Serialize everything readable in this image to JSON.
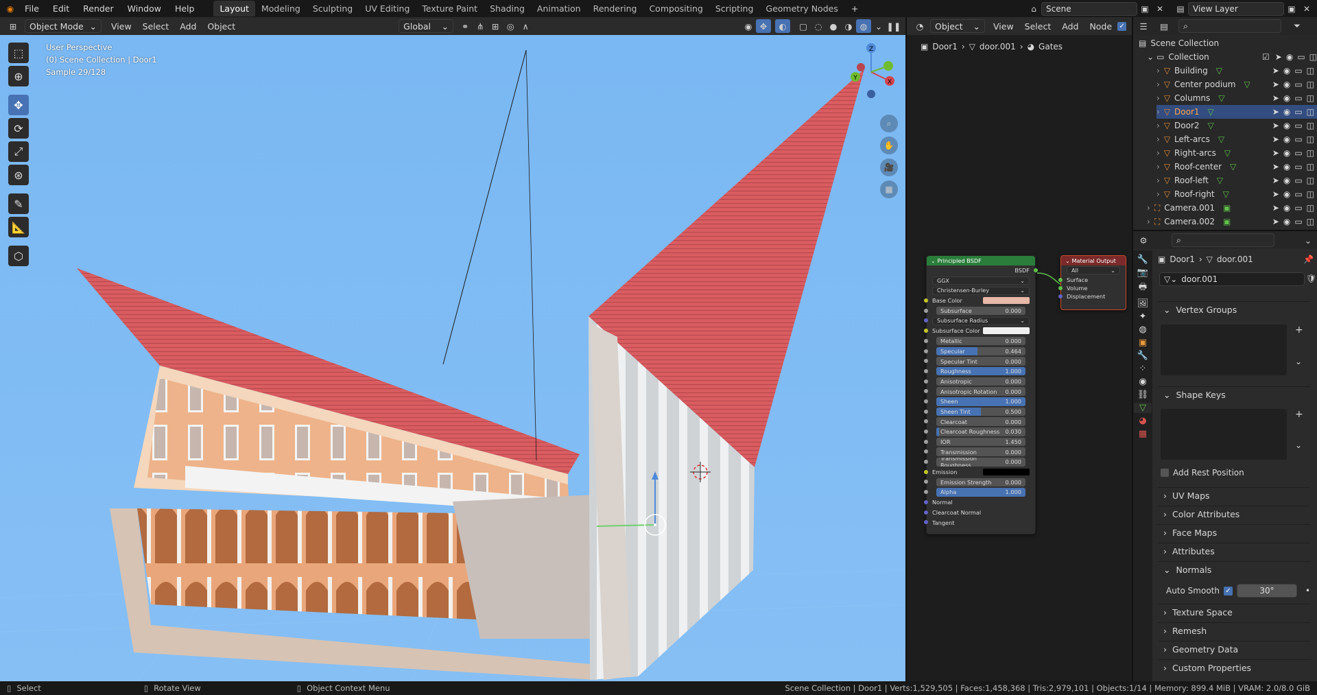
{
  "topbar": {
    "menus": [
      "File",
      "Edit",
      "Render",
      "Window",
      "Help"
    ],
    "workspaces": [
      "Layout",
      "Modeling",
      "Sculpting",
      "UV Editing",
      "Texture Paint",
      "Shading",
      "Animation",
      "Rendering",
      "Compositing",
      "Scripting",
      "Geometry Nodes"
    ],
    "active_workspace": "Layout",
    "add_tab": "+",
    "scene": "Scene",
    "view_layer": "View Layer"
  },
  "viewport": {
    "mode": "Object Mode",
    "menus": [
      "View",
      "Select",
      "Add",
      "Object"
    ],
    "orientation": "Global",
    "info_line1": "User Perspective",
    "info_line2": "(0) Scene Collection | Door1",
    "info_line3": "Sample 29/128",
    "gizmo": {
      "x": "X",
      "y": "Y",
      "z": "Z"
    },
    "colors": {
      "sky": "#79b6f1",
      "roof": "#d65a5e",
      "wall": "#e8a070"
    }
  },
  "node_editor": {
    "mode": "Object",
    "menus": [
      "View",
      "Select",
      "Add",
      "Node"
    ],
    "breadcrumb": [
      "Door1",
      "door.001",
      "Gates"
    ],
    "bsdf": {
      "title": "Principled BSDF",
      "output": "BSDF",
      "distribution": "GGX",
      "subsurface_method": "Christensen-Burley",
      "rows": [
        {
          "label": "Base Color",
          "type": "color",
          "color": "#e8b8a8"
        },
        {
          "label": "Subsurface",
          "value": "0.000",
          "fill": 0
        },
        {
          "label": "Subsurface Radius",
          "type": "dropdown"
        },
        {
          "label": "Subsurface Color",
          "type": "color",
          "color": "#f0f0f0"
        },
        {
          "label": "Metallic",
          "value": "0.000",
          "fill": 0
        },
        {
          "label": "Specular",
          "value": "0.464",
          "fill": 0.464
        },
        {
          "label": "Specular Tint",
          "value": "0.000",
          "fill": 0
        },
        {
          "label": "Roughness",
          "value": "1.000",
          "fill": 1
        },
        {
          "label": "Anisotropic",
          "value": "0.000",
          "fill": 0
        },
        {
          "label": "Anisotropic Rotation",
          "value": "0.000",
          "fill": 0
        },
        {
          "label": "Sheen",
          "value": "1.000",
          "fill": 1
        },
        {
          "label": "Sheen Tint",
          "value": "0.500",
          "fill": 0.5
        },
        {
          "label": "Clearcoat",
          "value": "0.000",
          "fill": 0
        },
        {
          "label": "Clearcoat Roughness",
          "value": "0.030",
          "fill": 0.03
        },
        {
          "label": "IOR",
          "value": "1.450",
          "fill": 0
        },
        {
          "label": "Transmission",
          "value": "0.000",
          "fill": 0
        },
        {
          "label": "Transmission Roughness",
          "value": "0.000",
          "fill": 0
        },
        {
          "label": "Emission",
          "type": "color",
          "color": "#000000"
        },
        {
          "label": "Emission Strength",
          "value": "0.000",
          "fill": 0
        },
        {
          "label": "Alpha",
          "value": "1.000",
          "fill": 1
        },
        {
          "label": "Normal",
          "type": "socket"
        },
        {
          "label": "Clearcoat Normal",
          "type": "socket"
        },
        {
          "label": "Tangent",
          "type": "socket"
        }
      ]
    },
    "output": {
      "title": "Material Output",
      "target": "All",
      "inputs": [
        "Surface",
        "Volume",
        "Displacement"
      ]
    }
  },
  "outliner": {
    "root": "Scene Collection",
    "collection": "Collection",
    "items": [
      {
        "name": "Building",
        "selected": false
      },
      {
        "name": "Center podium",
        "selected": false
      },
      {
        "name": "Columns",
        "selected": false
      },
      {
        "name": "Door1",
        "selected": true
      },
      {
        "name": "Door2",
        "selected": false
      },
      {
        "name": "Left-arcs",
        "selected": false
      },
      {
        "name": "Right-arcs",
        "selected": false
      },
      {
        "name": "Roof-center",
        "selected": false
      },
      {
        "name": "Roof-left",
        "selected": false
      },
      {
        "name": "Roof-right",
        "selected": false
      }
    ],
    "cameras": [
      "Camera.001",
      "Camera.002"
    ]
  },
  "properties": {
    "breadcrumb": [
      "Door1",
      "door.001"
    ],
    "mesh_name": "door.001",
    "vertex_groups": "Vertex Groups",
    "shape_keys": "Shape Keys",
    "add_rest_position": "Add Rest Position",
    "panels": [
      "UV Maps",
      "Color Attributes",
      "Face Maps",
      "Attributes"
    ],
    "normals": "Normals",
    "auto_smooth_label": "Auto Smooth",
    "auto_smooth_angle": "30°",
    "panels2": [
      "Texture Space",
      "Remesh",
      "Geometry Data",
      "Custom Properties"
    ]
  },
  "status": {
    "select": "Select",
    "rotate": "Rotate View",
    "context": "Object Context Menu",
    "stats": "Scene Collection | Door1 | Verts:1,529,505 | Faces:1,458,368 | Tris:2,979,101 | Objects:1/14 | Memory: 899.4 MiB | VRAM: 2.0/8.0 GiB"
  }
}
